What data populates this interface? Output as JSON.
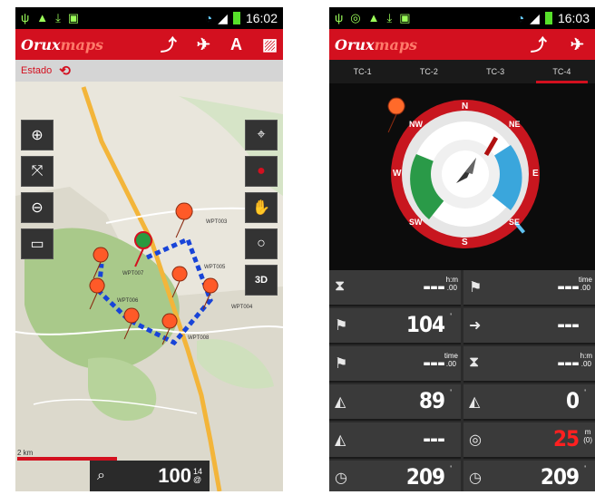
{
  "status_bar_left": {
    "time": "16:02"
  },
  "status_bar_right": {
    "time": "16:03"
  },
  "app_logo": {
    "part1": "Orux",
    "part2": "maps"
  },
  "map_screen": {
    "estado_label": "Estado",
    "scale_label": "2 km",
    "search_value": "100",
    "search_sup_top": "14",
    "search_sup_bottom": "@",
    "waypoint_labels": [
      "WPT003",
      "WPT007",
      "WPT006",
      "WPT005",
      "WPT004",
      "WPT008"
    ]
  },
  "compass_screen": {
    "tabs": [
      {
        "label": "TC-1"
      },
      {
        "label": "TC-2"
      },
      {
        "label": "TC-3"
      },
      {
        "label": "TC-4"
      }
    ],
    "compass_labels": {
      "N": "N",
      "NE": "NE",
      "E": "E",
      "SE": "SE",
      "S": "S",
      "SW": "SW",
      "W": "W",
      "NW": "NW"
    },
    "cells": [
      {
        "icon": "hourglass-icon",
        "value": "---",
        "unit": "h:m",
        "sub": ".00"
      },
      {
        "icon": "flag-icon",
        "value": "---",
        "unit": "time",
        "sub": ".00"
      },
      {
        "icon": "flag-icon",
        "value": "104",
        "unit": "",
        "sub": "'"
      },
      {
        "icon": "arrow-right-icon",
        "value": "---",
        "unit": "",
        "sub": ""
      },
      {
        "icon": "flag-icon",
        "value": "---",
        "unit": "time",
        "sub": ".00"
      },
      {
        "icon": "hourglass-icon",
        "value": "---",
        "unit": "h:m",
        "sub": ".00"
      },
      {
        "icon": "altitude-icon",
        "value": "89",
        "unit": "",
        "sub": "'"
      },
      {
        "icon": "altitude-icon",
        "value": "0",
        "unit": "",
        "sub": "'"
      },
      {
        "icon": "altitude-icon",
        "value": "---",
        "unit": "",
        "sub": ""
      },
      {
        "icon": "satellite-icon",
        "value": "25",
        "unit": "m",
        "sub": "(0)"
      },
      {
        "icon": "clock-icon",
        "value": "209",
        "unit": "",
        "sub": "'"
      },
      {
        "icon": "clock-icon",
        "value": "209",
        "unit": "",
        "sub": "'"
      }
    ]
  }
}
